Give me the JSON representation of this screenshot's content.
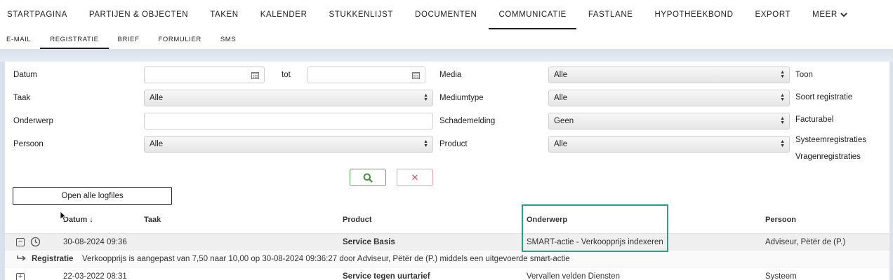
{
  "top_nav": {
    "items": [
      "STARTPAGINA",
      "PARTIJEN & OBJECTEN",
      "TAKEN",
      "KALENDER",
      "STUKKENLIJST",
      "DOCUMENTEN",
      "COMMUNICATIE",
      "FASTLANE",
      "HYPOTHEEKBOND",
      "EXPORT"
    ],
    "active": "COMMUNICATIE",
    "more_label": "MEER"
  },
  "sub_nav": {
    "items": [
      "E-MAIL",
      "REGISTRATIE",
      "BRIEF",
      "FORMULIER",
      "SMS"
    ],
    "active": "REGISTRATIE"
  },
  "filters": {
    "datum_label": "Datum",
    "tot_label": "tot",
    "taak_label": "Taak",
    "taak_value": "Alle",
    "onderwerp_label": "Onderwerp",
    "persoon_label": "Persoon",
    "persoon_value": "Alle",
    "media_label": "Media",
    "media_value": "Alle",
    "mediumtype_label": "Mediumtype",
    "mediumtype_value": "Alle",
    "schademelding_label": "Schademelding",
    "schademelding_value": "Geen",
    "product_label": "Product",
    "product_value": "Alle",
    "toon_label": "Toon",
    "soort_label": "Soort registratie",
    "facturabel_label": "Facturabel",
    "systeem_label": "Systeemregistraties",
    "vragen_label": "Vragenregistraties"
  },
  "actions": {
    "search_icon": "search-icon",
    "clear_symbol": "✕",
    "open_logfiles": "Open alle logfiles"
  },
  "table": {
    "headers": {
      "datum": "Datum",
      "datum_sort": "↓",
      "taak": "Taak",
      "product": "Product",
      "onderwerp": "Onderwerp",
      "persoon": "Persoon"
    },
    "rows": [
      {
        "datum": "30-08-2024 09:36",
        "product": "Service Basis",
        "onderwerp": "SMART-actie - Verkoopprijs indexeren",
        "persoon": "Adviseur, Pëtër de (P.)",
        "detail_label": "Registratie",
        "detail_text": "Verkoopprijs is aangepast van 7,50 naar 10,00 op 30-08-2024 09:36:27 door Adviseur, Pëtër de (P.) middels een uitgevoerde smart-actie"
      },
      {
        "datum": "22-03-2022 08:31",
        "product": "Service tegen uurtarief",
        "onderwerp": "Vervallen velden Diensten",
        "persoon": "Systeem"
      }
    ]
  },
  "colors": {
    "highlight": "#1aa888",
    "search_border": "#5aa35a",
    "clear_border": "#e2a1a8"
  }
}
